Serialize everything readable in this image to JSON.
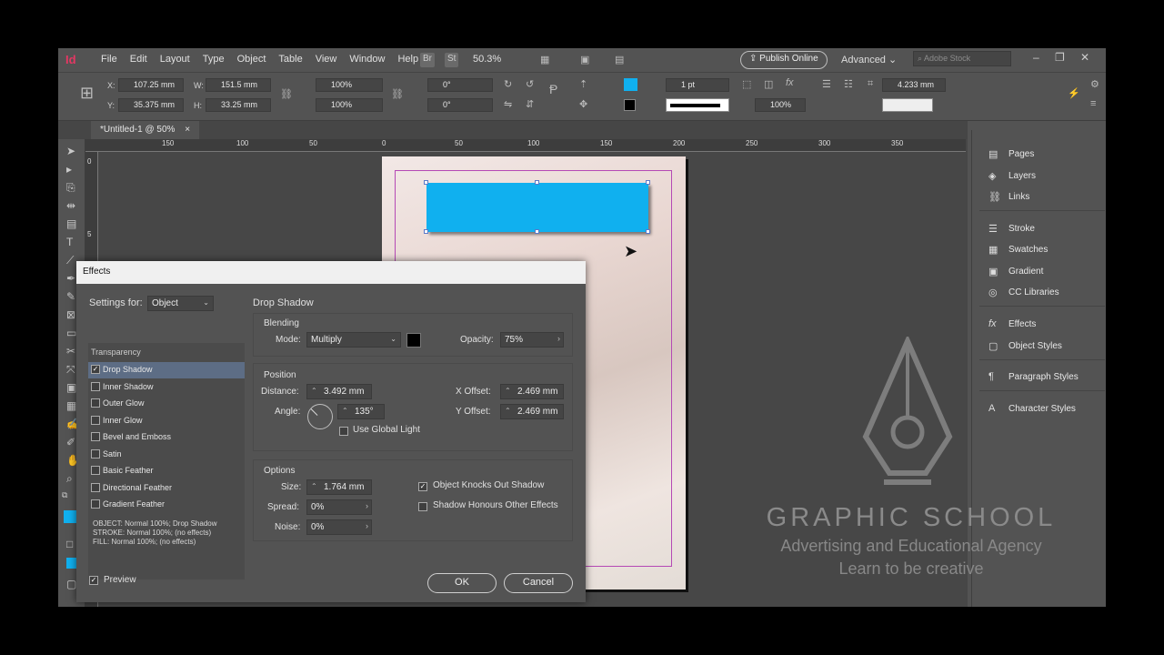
{
  "app": {
    "logo": "Id",
    "menu": [
      "File",
      "Edit",
      "Layout",
      "Type",
      "Object",
      "Table",
      "View",
      "Window",
      "Help"
    ],
    "bridge": "Br",
    "stock_btn": "St",
    "zoom": "50.3%",
    "publish": "Publish Online",
    "workspace": "Advanced",
    "search_placeholder": "Adobe Stock"
  },
  "control": {
    "x_label": "X:",
    "x": "107.25 mm",
    "y_label": "Y:",
    "y": "35.375 mm",
    "w_label": "W:",
    "w": "151.5 mm",
    "h_label": "H:",
    "h": "33.25 mm",
    "scale_x": "100%",
    "scale_y": "100%",
    "rotate": "0°",
    "shear": "0°",
    "stroke_weight": "1 pt",
    "opacity": "100%",
    "offset": "4.233 mm"
  },
  "tab": {
    "title": "*Untitled-1 @ 50%",
    "close": "×"
  },
  "ruler": {
    "h_ticks": [
      "150",
      "100",
      "50",
      "0",
      "50",
      "100",
      "150",
      "200",
      "250",
      "300",
      "350"
    ],
    "v_ticks": [
      "0",
      "5"
    ]
  },
  "panels": [
    {
      "label": "Pages",
      "icon": "pages-icon"
    },
    {
      "label": "Layers",
      "icon": "layers-icon"
    },
    {
      "label": "Links",
      "icon": "links-icon"
    },
    {
      "label": "Stroke",
      "icon": "stroke-icon"
    },
    {
      "label": "Swatches",
      "icon": "swatches-icon"
    },
    {
      "label": "Gradient",
      "icon": "gradient-icon"
    },
    {
      "label": "CC Libraries",
      "icon": "cc-libraries-icon"
    },
    {
      "label": "Effects",
      "icon": "effects-icon"
    },
    {
      "label": "Object Styles",
      "icon": "object-styles-icon"
    },
    {
      "label": "Paragraph Styles",
      "icon": "paragraph-styles-icon"
    },
    {
      "label": "Character Styles",
      "icon": "character-styles-icon"
    }
  ],
  "watermark": {
    "title": "GRAPHIC SCHOOL",
    "subtitle": "Advertising and Educational Agency",
    "tagline": "Learn to be creative"
  },
  "dialog": {
    "title": "Effects",
    "settings_for_label": "Settings for:",
    "settings_for_value": "Object",
    "section_title": "Drop Shadow",
    "transparency_label": "Transparency",
    "effects": [
      {
        "label": "Drop Shadow",
        "checked": true
      },
      {
        "label": "Inner Shadow",
        "checked": false
      },
      {
        "label": "Outer Glow",
        "checked": false
      },
      {
        "label": "Inner Glow",
        "checked": false
      },
      {
        "label": "Bevel and Emboss",
        "checked": false
      },
      {
        "label": "Satin",
        "checked": false
      },
      {
        "label": "Basic Feather",
        "checked": false
      },
      {
        "label": "Directional Feather",
        "checked": false
      },
      {
        "label": "Gradient Feather",
        "checked": false
      }
    ],
    "summary": [
      "OBJECT: Normal 100%; Drop Shadow",
      "STROKE: Normal 100%; (no effects)",
      "FILL: Normal 100%; (no effects)"
    ],
    "blending": {
      "title": "Blending",
      "mode_label": "Mode:",
      "mode": "Multiply",
      "opacity_label": "Opacity:",
      "opacity": "75%",
      "shadow_color": "#000000"
    },
    "position": {
      "title": "Position",
      "distance_label": "Distance:",
      "distance": "3.492 mm",
      "angle_label": "Angle:",
      "angle": "135°",
      "global_light": "Use Global Light",
      "xoffset_label": "X Offset:",
      "xoffset": "2.469 mm",
      "yoffset_label": "Y Offset:",
      "yoffset": "2.469 mm"
    },
    "options": {
      "title": "Options",
      "size_label": "Size:",
      "size": "1.764 mm",
      "spread_label": "Spread:",
      "spread": "0%",
      "noise_label": "Noise:",
      "noise": "0%",
      "knocks_out": "Object Knocks Out Shadow",
      "honours": "Shadow Honours Other Effects"
    },
    "preview": "Preview",
    "ok": "OK",
    "cancel": "Cancel"
  },
  "colors": {
    "object_fill": "#10b0ef",
    "margin_guide": "#b549b5"
  }
}
